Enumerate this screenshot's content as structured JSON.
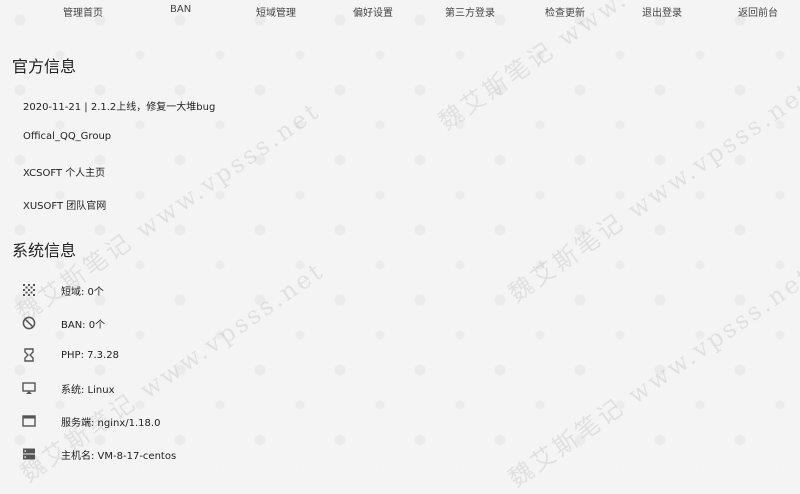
{
  "nav": [
    {
      "label": "管理首页"
    },
    {
      "label": "BAN"
    },
    {
      "label": "短域管理"
    },
    {
      "label": "偏好设置"
    },
    {
      "label": "第三方登录"
    },
    {
      "label": "检查更新"
    },
    {
      "label": "退出登录"
    },
    {
      "label": "返回前台"
    }
  ],
  "official": {
    "title": "官方信息",
    "links": [
      {
        "label": "2020-11-21 | 2.1.2上线，修复一大堆bug"
      },
      {
        "label": "Offical_QQ_Group"
      },
      {
        "label": "XCSOFT 个人主页"
      },
      {
        "label": "XUSOFT 团队官网"
      }
    ]
  },
  "system": {
    "title": "系统信息",
    "rows": [
      {
        "icon": "grid-dots-icon",
        "text": "短域: 0个"
      },
      {
        "icon": "block-icon",
        "text": "BAN: 0个"
      },
      {
        "icon": "hourglass-icon",
        "text": "PHP: 7.3.28"
      },
      {
        "icon": "monitor-icon",
        "text": "系统: Linux"
      },
      {
        "icon": "window-icon",
        "text": "服务端: nginx/1.18.0"
      },
      {
        "icon": "server-icon",
        "text": "主机名: VM-8-17-centos"
      }
    ]
  },
  "watermark": "魏艾斯笔记 www.vpsss.net"
}
